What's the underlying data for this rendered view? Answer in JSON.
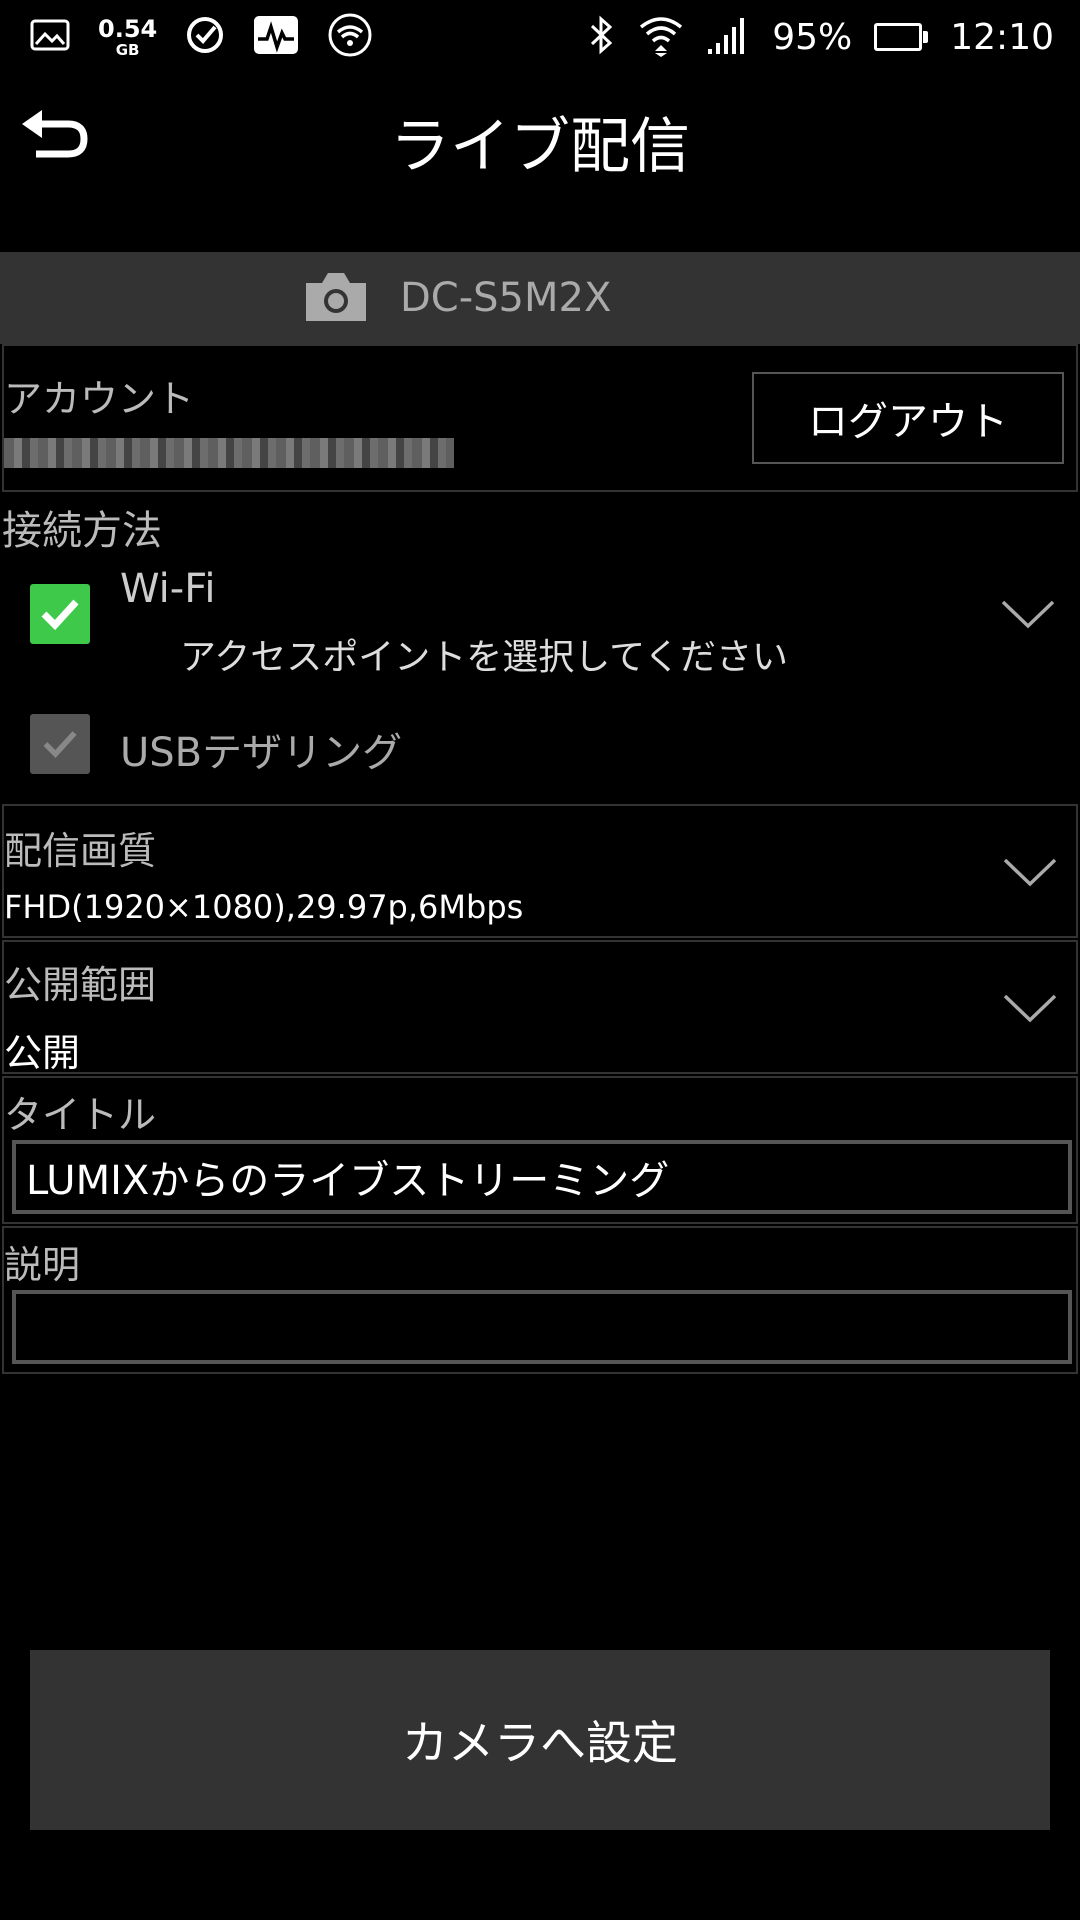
{
  "status_bar": {
    "data_usage": "0.54",
    "data_unit": "GB",
    "battery": "95%",
    "battery_level": 0.95,
    "time": "12:10"
  },
  "header": {
    "title": "ライブ配信"
  },
  "device": {
    "name": "DC-S5M2X"
  },
  "account": {
    "label": "アカウント",
    "logout_label": "ログアウト"
  },
  "connection": {
    "label": "接続方法",
    "wifi_label": "Wi-Fi",
    "wifi_sub": "アクセスポイントを選択してください",
    "usb_label": "USBテザリング"
  },
  "quality": {
    "label": "配信画質",
    "value": "FHD(1920×1080),29.97p,6Mbps"
  },
  "visibility": {
    "label": "公開範囲",
    "value": "公開"
  },
  "title": {
    "label": "タイトル",
    "value": "LUMIXからのライブストリーミング"
  },
  "description": {
    "label": "説明",
    "value": ""
  },
  "apply_button": {
    "label": "カメラへ設定"
  },
  "colors": {
    "check_green": "#3ec94a",
    "panel_gray": "#333333"
  }
}
